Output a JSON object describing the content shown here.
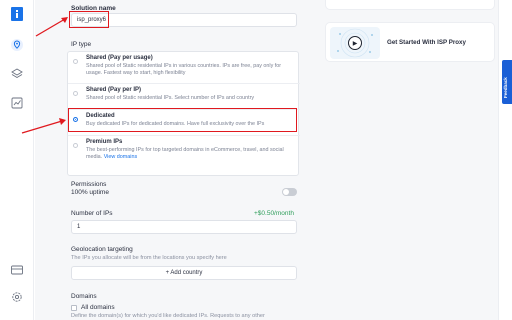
{
  "form": {
    "solution_name_label": "Solution name",
    "solution_name_value": "isp_proxy6",
    "ip_type_label": "IP type",
    "options": [
      {
        "title": "Shared (Pay per usage)",
        "desc": "Shared pool of Static residential IPs in various countries. IPs are free, pay only for usage. Fastest way to start, high flexibility",
        "selected": false
      },
      {
        "title": "Shared (Pay per IP)",
        "desc": "Shared pool of Static residential IPs. Select number of IPs and country",
        "selected": false
      },
      {
        "title": "Dedicated",
        "desc": "Buy dedicated IPs for dedicated domains. Have full exclusivity over the IPs",
        "selected": true
      },
      {
        "title": "Premium IPs",
        "desc": "The best-performing IPs for top targeted domains in eCommerce, travel, and social media.",
        "link": "View domains",
        "selected": false
      }
    ],
    "permissions_label": "Permissions",
    "uptime_label": "100% uptime",
    "num_ips_label": "Number of IPs",
    "num_ips_price": "+$0.50/month",
    "num_ips_value": "1",
    "geo_label": "Geolocation targeting",
    "geo_desc": "The IPs you allocate will be from the locations you specify here",
    "add_country_label": "+ Add country",
    "domains_label": "Domains",
    "all_domains_label": "All domains",
    "domains_desc": "Define the domain(s) for which you'd like dedicated IPs. Requests to any other"
  },
  "side_card": {
    "title": "Get Started With ISP Proxy"
  },
  "feedback_tab": "Feedback",
  "colors": {
    "accent": "#1a73e8",
    "annotation": "#e0191f",
    "feedback": "#1a5fd6"
  },
  "icons": [
    "info-icon",
    "location-pin-icon",
    "layers-icon",
    "chart-icon",
    "billing-icon",
    "settings-icon",
    "play-icon"
  ]
}
